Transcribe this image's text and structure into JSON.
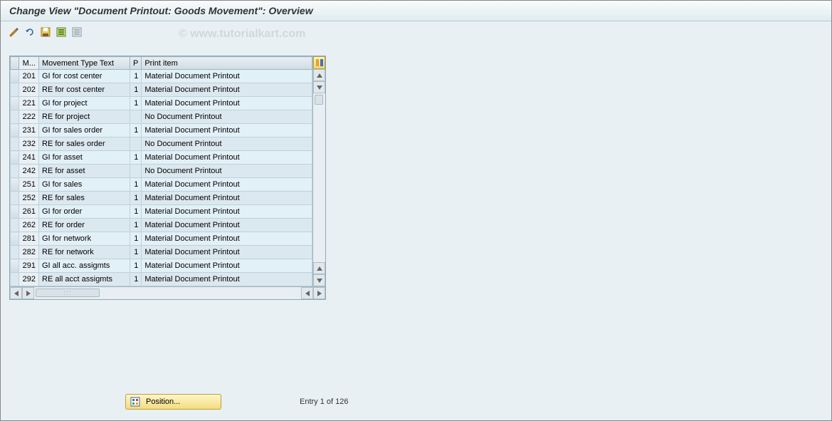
{
  "title": "Change View \"Document Printout: Goods Movement\": Overview",
  "watermark": "© www.tutorialkart.com",
  "toolbar": {
    "icons": [
      "change-icon",
      "undo-icon",
      "save-icon",
      "select-all-icon",
      "deselect-all-icon"
    ]
  },
  "table": {
    "headers": {
      "sel": "",
      "m": "M...",
      "txt": "Movement Type Text",
      "p": "P",
      "print": "Print item"
    },
    "rows": [
      {
        "m": "201",
        "txt": "GI for cost center",
        "p": "1",
        "print": "Material Document Printout"
      },
      {
        "m": "202",
        "txt": "RE for cost center",
        "p": "1",
        "print": "Material Document Printout"
      },
      {
        "m": "221",
        "txt": "GI for project",
        "p": "1",
        "print": "Material Document Printout"
      },
      {
        "m": "222",
        "txt": "RE for project",
        "p": "",
        "print": "No Document Printout"
      },
      {
        "m": "231",
        "txt": "GI for sales order",
        "p": "1",
        "print": "Material Document Printout"
      },
      {
        "m": "232",
        "txt": "RE for sales order",
        "p": "",
        "print": "No Document Printout"
      },
      {
        "m": "241",
        "txt": "GI for asset",
        "p": "1",
        "print": "Material Document Printout"
      },
      {
        "m": "242",
        "txt": "RE for asset",
        "p": "",
        "print": "No Document Printout"
      },
      {
        "m": "251",
        "txt": "GI for sales",
        "p": "1",
        "print": "Material Document Printout"
      },
      {
        "m": "252",
        "txt": "RE for sales",
        "p": "1",
        "print": "Material Document Printout"
      },
      {
        "m": "261",
        "txt": "GI for order",
        "p": "1",
        "print": "Material Document Printout"
      },
      {
        "m": "262",
        "txt": "RE for order",
        "p": "1",
        "print": "Material Document Printout"
      },
      {
        "m": "281",
        "txt": "GI for network",
        "p": "1",
        "print": "Material Document Printout"
      },
      {
        "m": "282",
        "txt": "RE for network",
        "p": "1",
        "print": "Material Document Printout"
      },
      {
        "m": "291",
        "txt": "GI all acc. assigmts",
        "p": "1",
        "print": "Material Document Printout"
      },
      {
        "m": "292",
        "txt": "RE all acct assigmts",
        "p": "1",
        "print": "Material Document Printout"
      }
    ]
  },
  "footer": {
    "position_label": "Position...",
    "entry_text": "Entry 1 of 126"
  }
}
